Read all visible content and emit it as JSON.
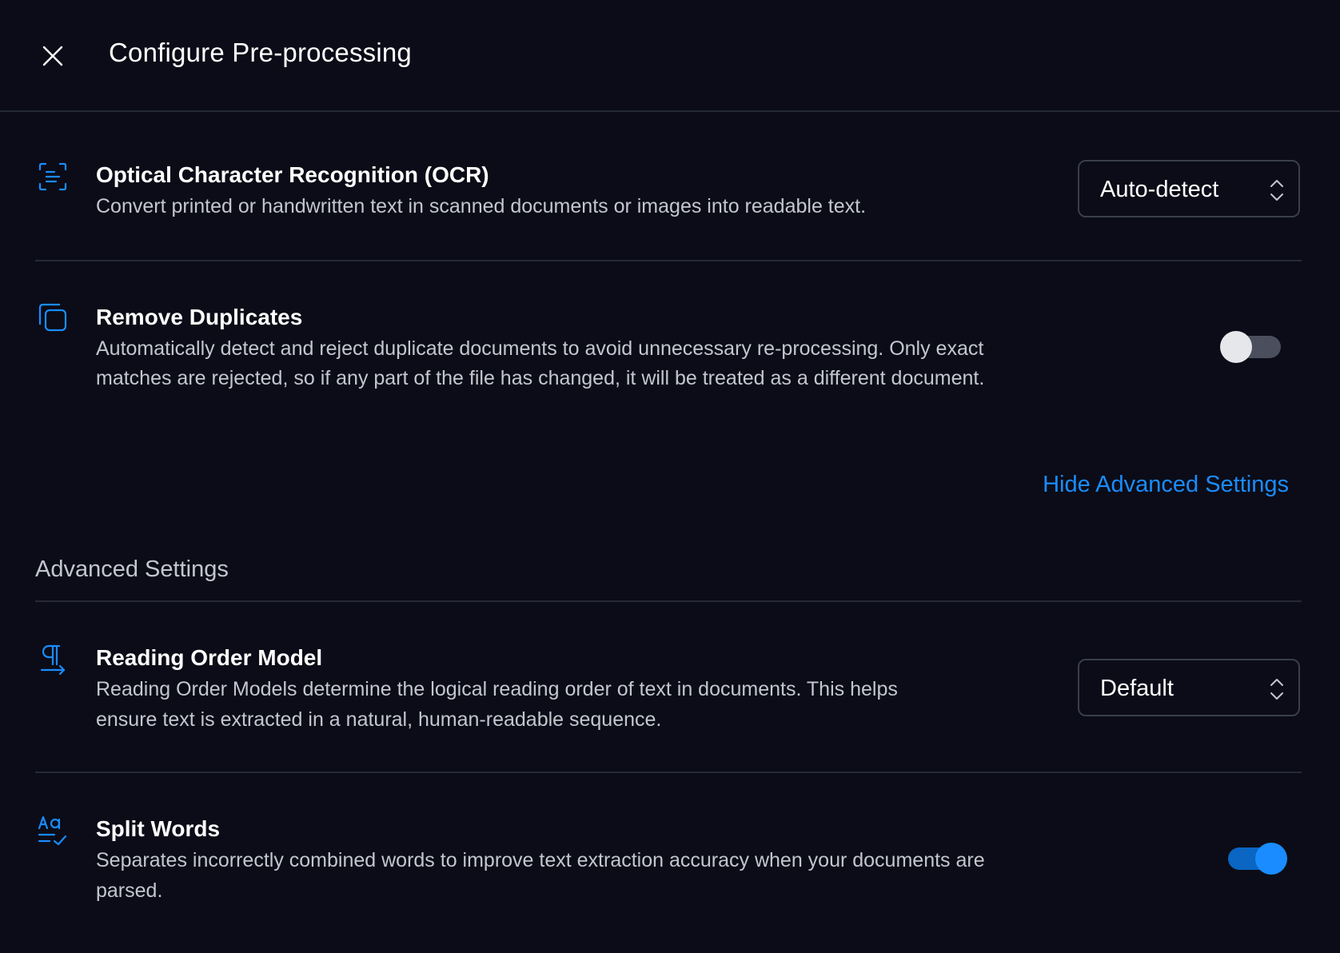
{
  "header": {
    "title": "Configure Pre-processing"
  },
  "ocr": {
    "title": "Optical Character Recognition (OCR)",
    "description": "Convert printed or handwritten text in scanned documents or images into readable text.",
    "select_value": "Auto-detect",
    "icon": "scan-text-icon"
  },
  "remove_duplicates": {
    "title": "Remove Duplicates",
    "description_line1": "Automatically detect and reject duplicate documents to avoid unnecessary re-processing. Only exact",
    "description_line2": "matches are rejected, so if any part of the file has changed, it will be treated as a different document.",
    "enabled": false,
    "icon": "copy-icon"
  },
  "advanced_toggle_label": "Hide Advanced Settings",
  "advanced_section_title": "Advanced Settings",
  "reading_order": {
    "title": "Reading Order Model",
    "description_line1": "Reading Order Models determine the logical reading order of text in documents. This helps",
    "description_line2": "ensure text is extracted in a natural, human-readable sequence.",
    "select_value": "Default",
    "icon": "pilcrow-arrow-icon"
  },
  "split_words": {
    "title": "Split Words",
    "description_line1": "Separates incorrectly combined words to improve text extraction accuracy when your documents are",
    "description_line2": "parsed.",
    "enabled": true,
    "icon": "spell-check-icon"
  },
  "colors": {
    "background": "#0b0c17",
    "accent": "#1a8cff",
    "icon": "#1a8cff",
    "divider": "#262a36"
  }
}
